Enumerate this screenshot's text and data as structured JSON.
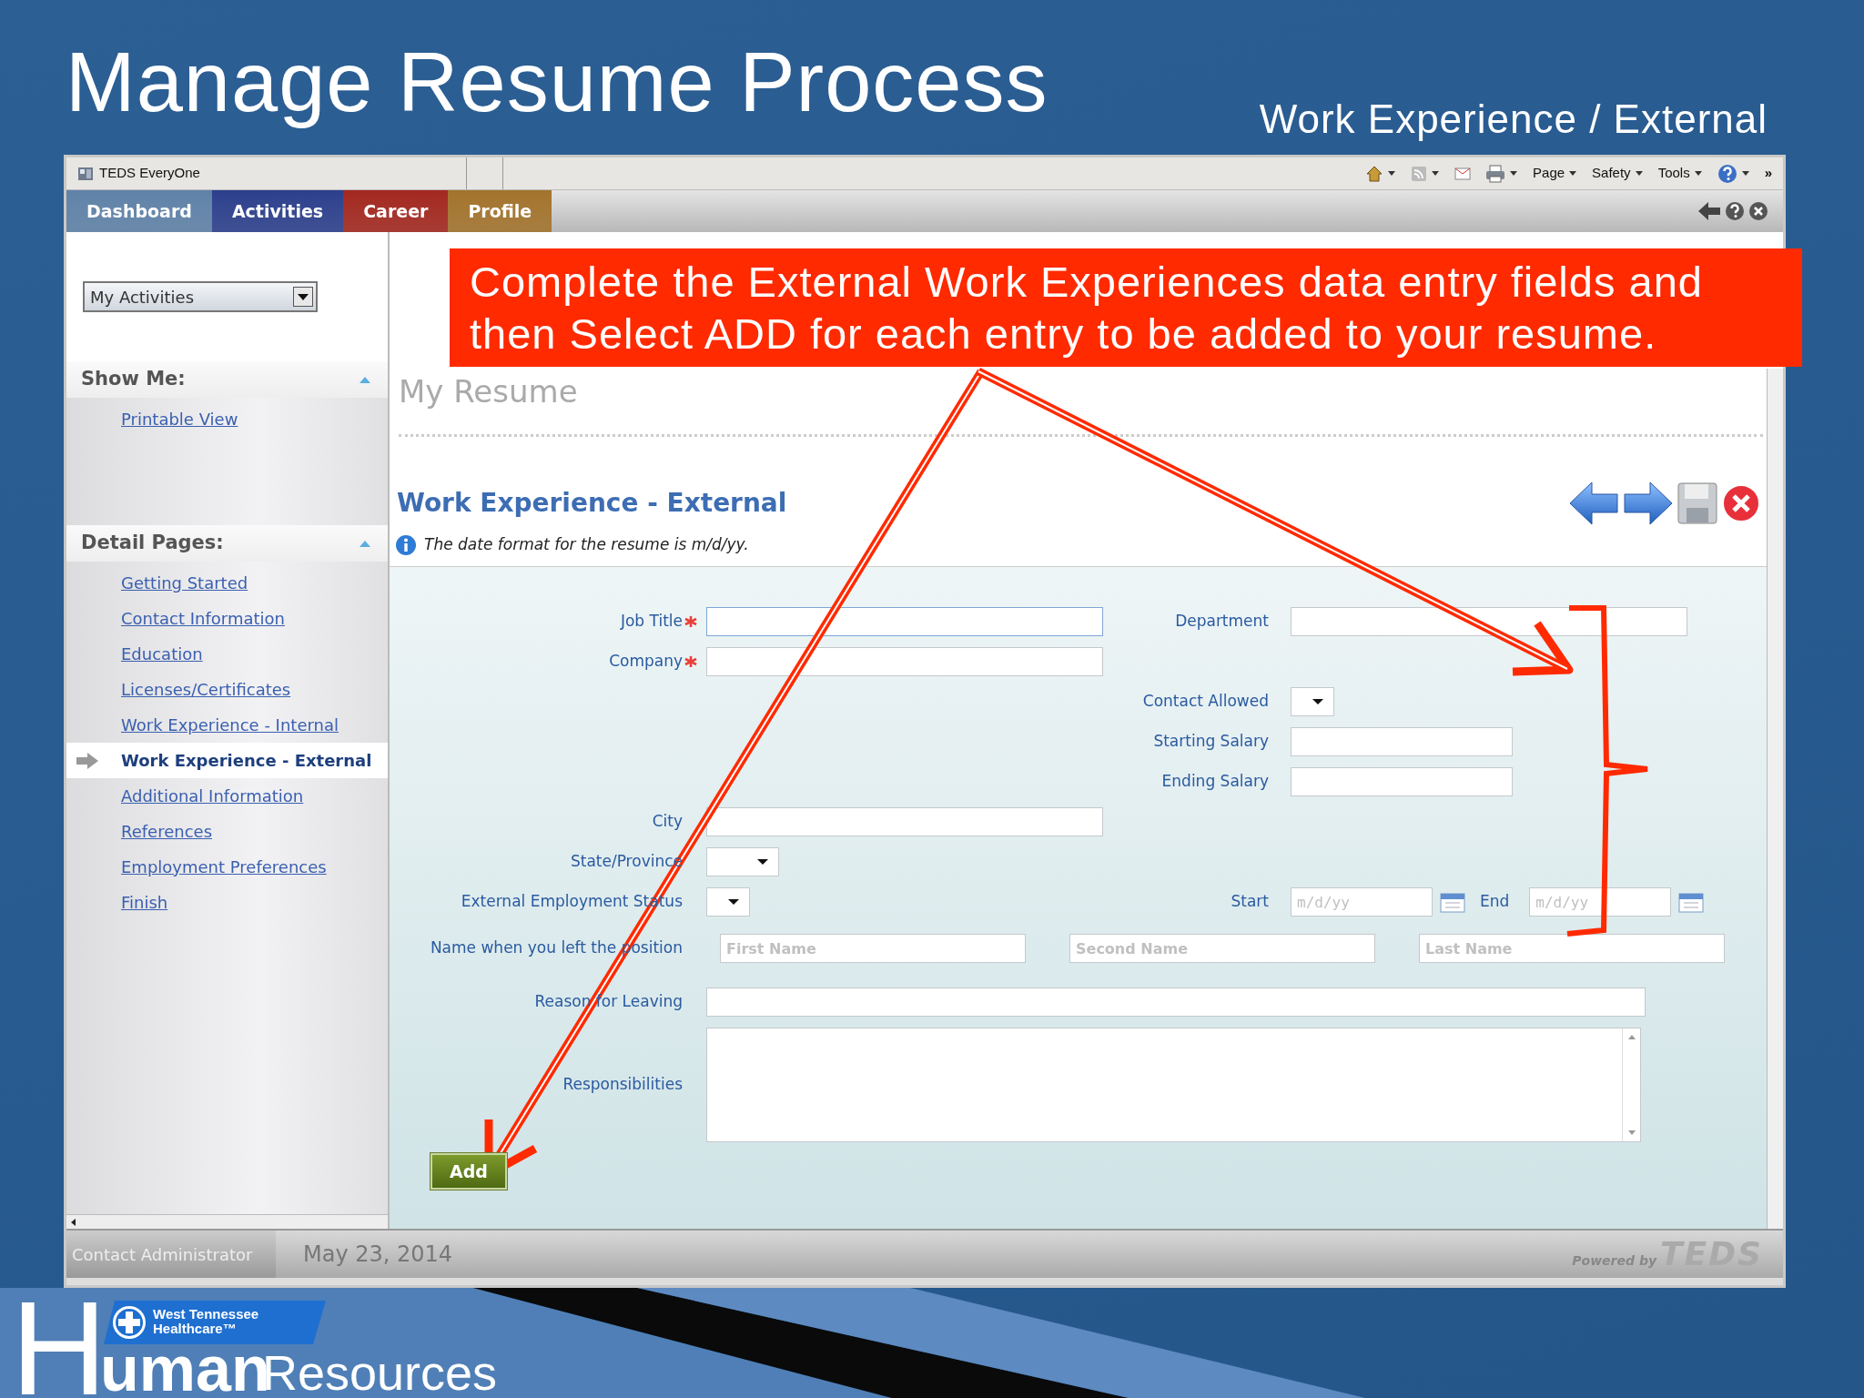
{
  "slide": {
    "title": "Manage Resume Process",
    "subtitle": "Work Experience / External"
  },
  "browser": {
    "tab_title": "TEDS EveryOne",
    "menus": [
      "Page",
      "Safety",
      "Tools"
    ],
    "overflow": "»"
  },
  "nav_tabs": [
    {
      "label": "Dashboard",
      "color": "#5f82a8"
    },
    {
      "label": "Activities",
      "color": "#2c3f8c"
    },
    {
      "label": "Career",
      "color": "#a3281f"
    },
    {
      "label": "Profile",
      "color": "#a3732c"
    }
  ],
  "activities_select": {
    "value": "My Activities"
  },
  "sidebar": [
    {
      "title": "Show Me:",
      "expanded": true,
      "items": [
        {
          "label": "Printable View",
          "selected": false
        }
      ]
    },
    {
      "title": "Detail Pages:",
      "expanded": true,
      "items": [
        {
          "label": "Getting Started",
          "selected": false
        },
        {
          "label": "Contact Information",
          "selected": false
        },
        {
          "label": "Education",
          "selected": false
        },
        {
          "label": "Licenses/Certificates",
          "selected": false
        },
        {
          "label": "Work Experience - Internal",
          "selected": false
        },
        {
          "label": "Work Experience - External",
          "selected": true
        },
        {
          "label": "Additional Information",
          "selected": false
        },
        {
          "label": "References",
          "selected": false
        },
        {
          "label": "Employment Preferences",
          "selected": false
        },
        {
          "label": "Finish",
          "selected": false
        }
      ]
    }
  ],
  "page": {
    "title": "My Resume",
    "section_title": "Work Experience - External",
    "info": "The date format for the resume is m/d/yy."
  },
  "form": [
    {
      "left": {
        "kind": "text",
        "label": "Job Title",
        "required": true,
        "focused": true
      },
      "right": {
        "kind": "text",
        "label": "Department",
        "focused": false
      }
    },
    {
      "left": {
        "kind": "text",
        "label": "Company",
        "required": true,
        "focused": false
      }
    },
    {
      "right": {
        "kind": "select",
        "label": "Contact Allowed"
      }
    },
    {
      "right": {
        "kind": "short",
        "label": "Starting Salary",
        "focused": false
      }
    },
    {
      "right": {
        "kind": "short",
        "label": "Ending Salary",
        "focused": false
      }
    },
    {
      "left": {
        "kind": "text",
        "label": "City",
        "required": false,
        "focused": false
      }
    },
    {
      "left": {
        "kind": "select",
        "label": "State/Province",
        "required": false
      }
    },
    {
      "left": {
        "kind": "select_small",
        "label": "External Employment Status",
        "required": false
      },
      "right": {
        "kind": "dates",
        "label": "Start",
        "placeholder": "m/d/yy",
        "end_label": "End",
        "end_placeholder": "m/d/yy"
      }
    },
    {
      "left": {
        "kind": "names",
        "label": "Name when you left the position",
        "required": false,
        "placeholders": [
          "First Name",
          "Second Name",
          "Last Name"
        ]
      }
    },
    {
      "left": {
        "kind": "wide",
        "label": "Reason for Leaving",
        "required": false,
        "focused": false
      }
    },
    {
      "left": {
        "kind": "textarea",
        "label": "Responsibilities",
        "required": false
      }
    }
  ],
  "add_button": "Add",
  "footer": {
    "contact": "Contact Administrator",
    "date": "May 23, 2014",
    "powered_by": "Powered by",
    "brand": "TEDS"
  },
  "callout": "Complete the External Work Experiences data entry fields and then Select ADD for each entry to be added to your resume.",
  "branding": {
    "initial": "H",
    "rest": "uman",
    "word": "Resources",
    "badge_line1": "West Tennessee",
    "badge_line2": "Healthcare™"
  }
}
